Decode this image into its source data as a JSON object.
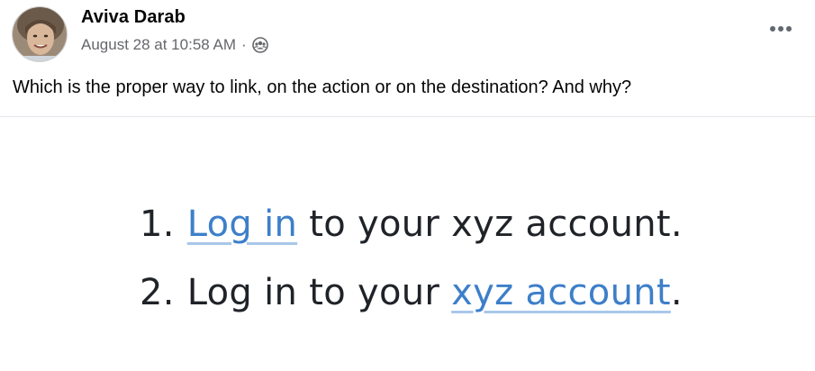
{
  "post": {
    "author": "Aviva Darab",
    "timestamp": "August 28 at 10:58 AM",
    "separator": "·",
    "audience_icon": "friends-icon",
    "more_icon": "more-options-icon",
    "text": "Which is the proper way to link, on the action or on the destination? And why?"
  },
  "image": {
    "line1": {
      "number": "1.",
      "link": "Log in",
      "rest": " to your xyz account."
    },
    "line2": {
      "number": "2.",
      "before": "Log in to your ",
      "link": "xyz account",
      "after": "."
    }
  },
  "colors": {
    "link": "#3d7fc9",
    "link_underline": "#a9c7ea",
    "meta_text": "#65676b",
    "image_text": "#1f2328"
  }
}
